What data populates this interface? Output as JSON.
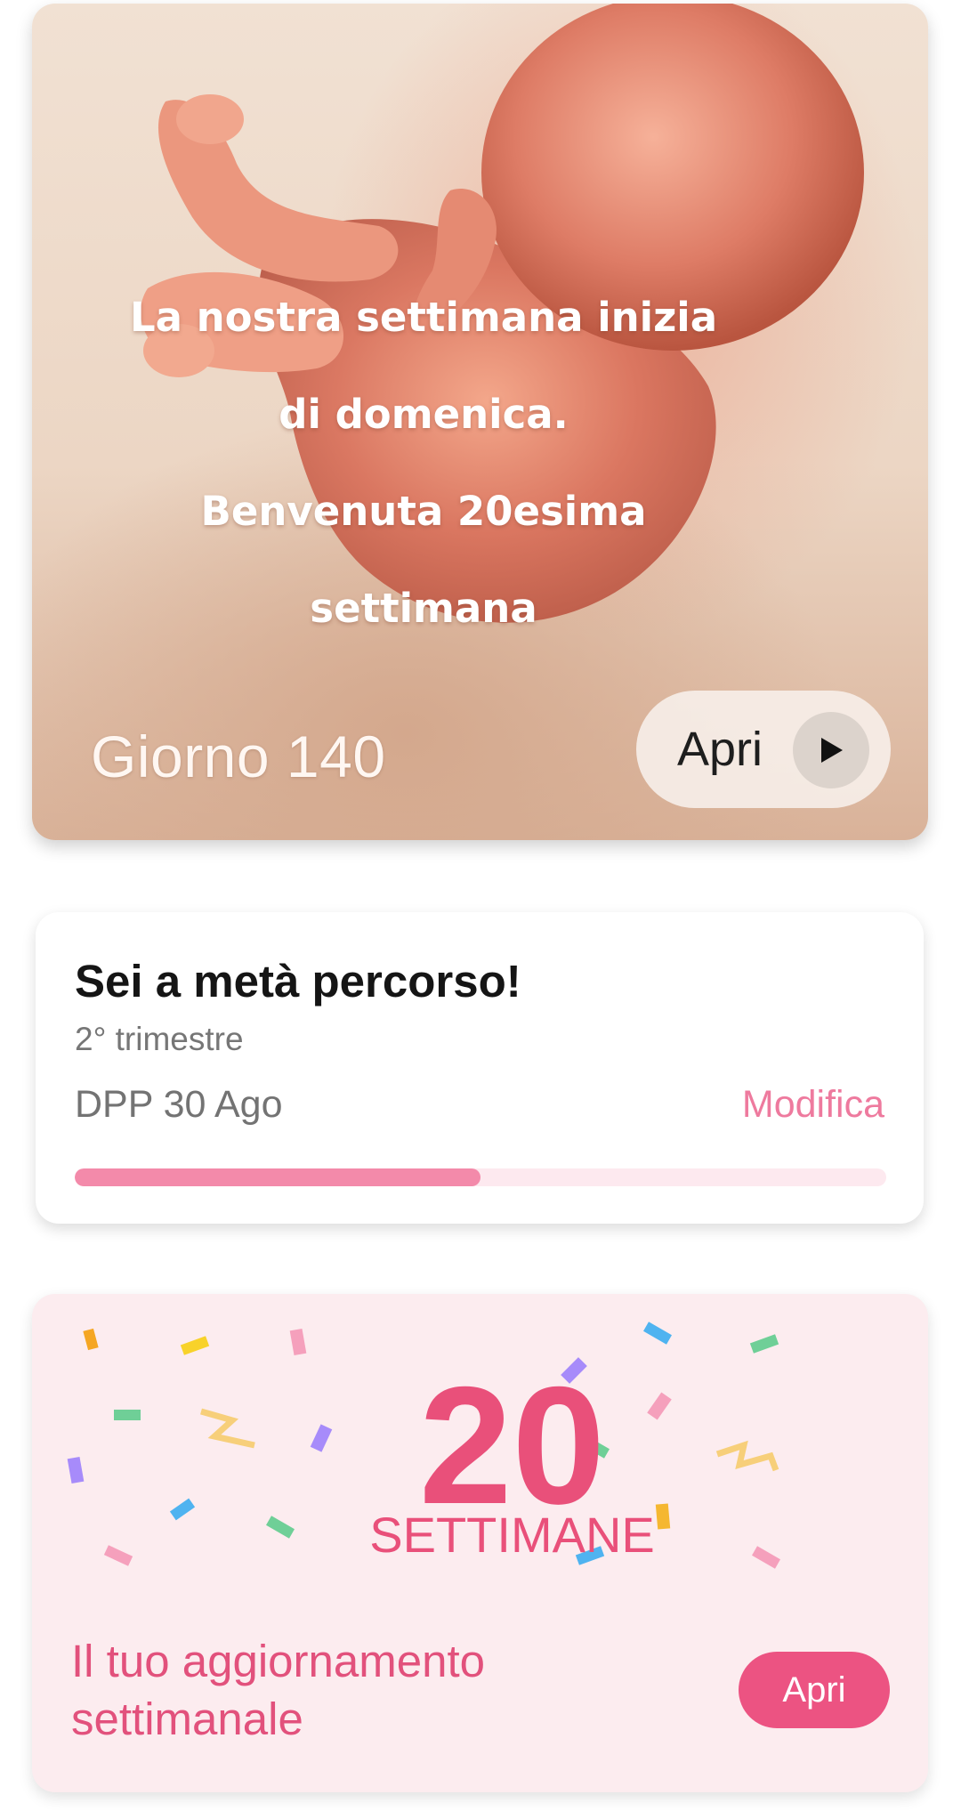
{
  "hero": {
    "headline_lines": [
      "La nostra settimana inizia",
      "di domenica.",
      "Benvenuta 20esima",
      "settimana"
    ],
    "day_label": "Giorno 140",
    "open_label": "Apri",
    "play_icon": "play-icon"
  },
  "progress": {
    "title": "Sei a metà percorso!",
    "trimester": "2° trimestre",
    "due_date": "DPP 30 Ago",
    "edit_label": "Modifica",
    "progress_fraction": 0.5,
    "fill_color": "#f38aaa",
    "track_color": "#fde9ef"
  },
  "weekly": {
    "week_number": "20",
    "week_word": "SETTIMANE",
    "update_text": "Il tuo aggiornamento settimanale",
    "open_label": "Apri",
    "accent_color": "#e9507a",
    "background_color": "#fcecef"
  }
}
